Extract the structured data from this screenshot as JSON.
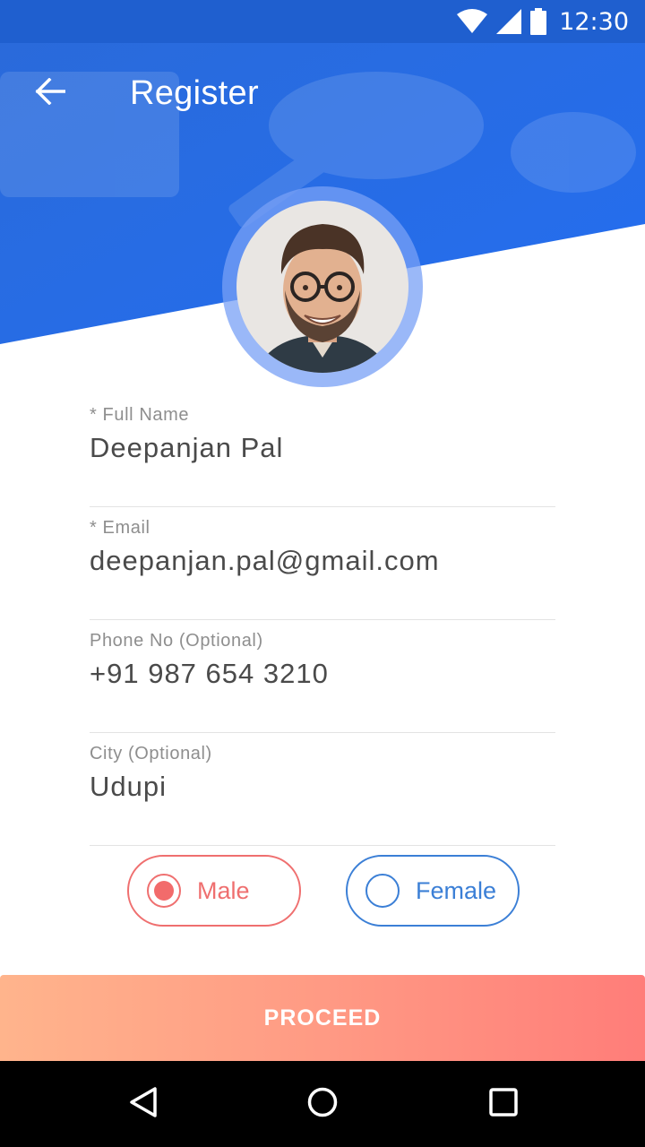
{
  "status_bar": {
    "time": "12:30",
    "icons": [
      "wifi-icon",
      "signal-icon",
      "battery-icon"
    ]
  },
  "app_bar": {
    "title": "Register",
    "back_icon": "arrow-left-icon"
  },
  "profile": {
    "avatar": "user-avatar-photo"
  },
  "form": {
    "fields": [
      {
        "label": "* Full Name",
        "value": "Deepanjan Pal"
      },
      {
        "label": "* Email",
        "value": "deepanjan.pal@gmail.com"
      },
      {
        "label": "Phone No (Optional)",
        "value": "+91 987 654 3210"
      },
      {
        "label": "City (Optional)",
        "value": "Udupi"
      }
    ]
  },
  "gender": {
    "options": [
      {
        "label": "Male",
        "selected": true
      },
      {
        "label": "Female",
        "selected": false
      }
    ]
  },
  "proceed": {
    "label": "PROCEED"
  },
  "navigation": {
    "icons": [
      "back-triangle-icon",
      "home-circle-icon",
      "recents-square-icon"
    ]
  },
  "colors": {
    "primary": "#2b6fe0",
    "accent": "#ef6f6f",
    "female": "#3b7fd6"
  }
}
